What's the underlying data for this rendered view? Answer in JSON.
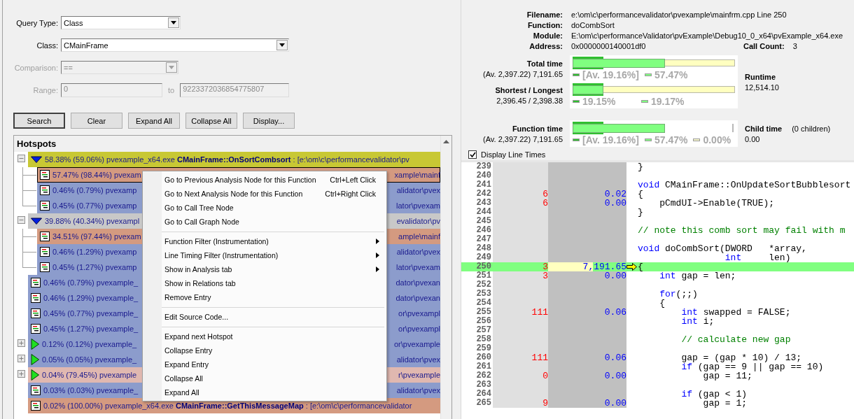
{
  "query_form": {
    "fields": [
      {
        "kind": "combo",
        "label": "Query Type:",
        "value": "Class",
        "disabled": false
      },
      {
        "kind": "combo",
        "label": "Class:",
        "value": "CMainFrame",
        "disabled": false
      },
      {
        "kind": "combo",
        "label": "Comparison:",
        "value": "==",
        "disabled": true
      },
      {
        "kind": "range",
        "label": "Range:",
        "value": "0",
        "separator": "to",
        "value_to": "9223372036854775807",
        "disabled": true
      }
    ],
    "buttons": [
      {
        "label": "Search",
        "default": true
      },
      {
        "label": "Clear",
        "default": false
      },
      {
        "label": "Expand All",
        "default": false
      },
      {
        "label": "Collapse All",
        "default": false
      },
      {
        "label": "Display...",
        "default": false
      }
    ]
  },
  "hotspots": {
    "title": "Hotspots",
    "rows": [
      {
        "kind": "group",
        "expanded": true,
        "selected": false,
        "color": "#c8c834",
        "text": "58.38% (59.06%) pvexample_x64.exe **CMainFrame::OnSortCombsort** : [e:\\om\\c\\performancevalidator\\pv",
        "children": [
          {
            "kind": "leaf",
            "selected": true,
            "color": "#d49a80",
            "text": "57.47% (98.44%) pvexam",
            "tail": "xample\\mainf"
          },
          {
            "kind": "leaf",
            "selected": false,
            "color": "#8c9ccc",
            "text": "0.46% (0.79%) pvexamp",
            "tail": "alidator\\pvex"
          },
          {
            "kind": "leaf",
            "selected": false,
            "color": "#8c9ccc",
            "text": "0.45% (0.77%) pvexamp",
            "tail": "lator\\pvexam"
          }
        ]
      },
      {
        "kind": "group",
        "expanded": true,
        "selected": false,
        "color": "#c8c8c8",
        "text": "39.88% (40.34%) pvexampl",
        "tail": "evalidator\\pv",
        "children": [
          {
            "kind": "leaf",
            "selected": false,
            "color": "#d49a80",
            "text": "34.51% (97.44%) pvexam",
            "tail": "ample\\mainf"
          },
          {
            "kind": "leaf",
            "selected": false,
            "color": "#8c9ccc",
            "text": "0.46% (1.29%) pvexamp",
            "tail": "alidator\\pvex"
          },
          {
            "kind": "leaf",
            "selected": false,
            "color": "#8c9ccc",
            "text": "0.45% (1.27%) pvexamp",
            "tail": "lator\\pvexam"
          }
        ]
      },
      {
        "kind": "leaf",
        "selected": false,
        "color": "#8c9ccc",
        "text": "0.46% (0.79%) pvexample_",
        "tail": "dator\\pvexan"
      },
      {
        "kind": "leaf",
        "selected": false,
        "color": "#8c9ccc",
        "text": "0.46% (1.29%) pvexample_",
        "tail": "dator\\pvexan"
      },
      {
        "kind": "leaf",
        "selected": false,
        "color": "#8c9ccc",
        "text": "0.45% (0.77%) pvexample_",
        "tail": "or\\pvexampl"
      },
      {
        "kind": "leaf",
        "selected": false,
        "color": "#8c9ccc",
        "text": "0.45% (1.27%) pvexample_",
        "tail": "or\\pvexampl"
      },
      {
        "kind": "group",
        "expanded": false,
        "selected": false,
        "color": "#8c9ccc",
        "text": "0.12% (0.12%) pvexample_",
        "tail": "or\\pvexample"
      },
      {
        "kind": "group",
        "expanded": false,
        "selected": false,
        "color": "#8c9ccc",
        "text": "0.05% (0.05%) pvexample_",
        "tail": "alidator\\pvex"
      },
      {
        "kind": "group",
        "expanded": false,
        "selected": false,
        "color": "#e0b8b0",
        "text": "0.04% (79.45%) pvexample",
        "tail": "r\\pvexample"
      },
      {
        "kind": "leaf",
        "selected": false,
        "color": "#8c9ccc",
        "text": "0.03% (0.03%) pvexample_",
        "tail": "alidator\\pvex"
      },
      {
        "kind": "leaf",
        "selected": false,
        "color": "#d49a80",
        "text": "0.02% (100.00%) pvexample_x64.exe **CMainFrame::GetThisMessageMap** : [e:\\om\\c\\performancevalidator"
      }
    ]
  },
  "context_menu": {
    "items": [
      {
        "kind": "item",
        "label": "Go to Previous Analysis Node for this Function",
        "shortcut": "Ctrl+Left Click",
        "submenu": false
      },
      {
        "kind": "item",
        "label": "Go to Next Analysis Node for this Function",
        "shortcut": "Ctrl+Right Click",
        "submenu": false
      },
      {
        "kind": "item",
        "label": "Go to Call Tree Node",
        "submenu": false
      },
      {
        "kind": "item",
        "label": "Go to Call Graph Node",
        "submenu": false
      },
      {
        "kind": "separator"
      },
      {
        "kind": "item",
        "label": "Function Filter (Instrumentation)",
        "submenu": true
      },
      {
        "kind": "item",
        "label": "Line Timing Filter (Instrumentation)",
        "submenu": true
      },
      {
        "kind": "item",
        "label": "Show in Analysis tab",
        "submenu": true
      },
      {
        "kind": "item",
        "label": "Show in Relations tab",
        "submenu": false
      },
      {
        "kind": "item",
        "label": "Remove Entry",
        "submenu": false
      },
      {
        "kind": "separator"
      },
      {
        "kind": "item",
        "label": "Edit Source Code...",
        "submenu": false
      },
      {
        "kind": "separator"
      },
      {
        "kind": "item",
        "label": "Expand next Hotspot",
        "submenu": false
      },
      {
        "kind": "item",
        "label": "Collapse Entry",
        "submenu": false
      },
      {
        "kind": "item",
        "label": "Expand Entry",
        "submenu": false
      },
      {
        "kind": "item",
        "label": "Collapse All",
        "submenu": false
      },
      {
        "kind": "item",
        "label": "Expand All",
        "submenu": false
      }
    ]
  },
  "details": {
    "fields": [
      {
        "label": "Filename:",
        "value": "e:\\om\\c\\performancevalidator\\pvexample\\mainfrm.cpp Line 250"
      },
      {
        "label": "Function:",
        "value": "doCombSort"
      },
      {
        "label": "Module:",
        "value": "E:\\om\\c\\performanceValidator\\pvExample\\Debug10_0_x64\\pvExample_x64.exe"
      },
      {
        "label": "Address:",
        "value": "0x0000000140001df0"
      }
    ],
    "call_count": {
      "label": "Call Count:",
      "value": "3"
    }
  },
  "timing_groups": [
    {
      "meters": [
        {
          "title": "Total time",
          "value": "(Av. 2,397.22) 7,191.65",
          "track": true,
          "fills": [
            {
              "kind": "avg",
              "level": 0.19
            },
            {
              "kind": "value",
              "level": 0.57
            }
          ],
          "legend": [
            {
              "kind": "avg",
              "text": "[Av. 19.16%]"
            },
            {
              "kind": "value",
              "text": "57.47%"
            }
          ]
        },
        {
          "title": "Shortest / Longest",
          "value": "2,396.45 / 2,398.38",
          "track": true,
          "fills": [
            {
              "kind": "avg",
              "level": 0.19
            },
            {
              "kind": "value",
              "level": 0.19
            }
          ],
          "legend": [
            {
              "kind": "avg",
              "text": "19.15%"
            },
            {
              "kind": "value",
              "text": "19.17%"
            }
          ]
        }
      ],
      "side": {
        "title": "Runtime",
        "value": "12,514.10"
      }
    },
    {
      "meters": [
        {
          "title": "Function time",
          "value": "(Av. 2,397.22) 7,191.65",
          "track": false,
          "fills": [
            {
              "kind": "avg",
              "level": 0.19
            },
            {
              "kind": "value",
              "level": 0.57
            }
          ],
          "legend": [
            {
              "kind": "avg",
              "text": "[Av. 19.16%]"
            },
            {
              "kind": "value",
              "text": "57.47%"
            },
            {
              "kind": "rest",
              "text": "0.00%"
            }
          ]
        }
      ],
      "side": {
        "title": "Child time",
        "note": "(0 children)",
        "value": "0.00"
      }
    }
  ],
  "line_times_option": {
    "label": "Display Line Times",
    "checked": true
  },
  "code_lines": [
    {
      "number": "239",
      "current": false,
      "tokens": [
        {
          "kind": "plain",
          "text": "}"
        }
      ]
    },
    {
      "number": "240",
      "current": false
    },
    {
      "number": "241",
      "current": false,
      "tokens": [
        {
          "kind": "keyword",
          "text": "void"
        },
        {
          "kind": "plain",
          "text": " CMainFrame::OnUpdateSortBubblesort"
        }
      ]
    },
    {
      "number": "242",
      "count": "6",
      "time": "0.02",
      "current": false,
      "tokens": [
        {
          "kind": "plain",
          "text": "{"
        }
      ]
    },
    {
      "number": "243",
      "count": "6",
      "time": "0.00",
      "current": false,
      "tokens": [
        {
          "kind": "plain",
          "text": "    pCmdUI->Enable(TRUE);"
        }
      ]
    },
    {
      "number": "244",
      "current": false,
      "tokens": [
        {
          "kind": "plain",
          "text": "}"
        }
      ]
    },
    {
      "number": "245",
      "current": false
    },
    {
      "number": "246",
      "current": false,
      "tokens": [
        {
          "kind": "comment",
          "text": "// note this comb sort may fail with m"
        }
      ]
    },
    {
      "number": "247",
      "current": false
    },
    {
      "number": "248",
      "current": false,
      "tokens": [
        {
          "kind": "keyword",
          "text": "void"
        },
        {
          "kind": "plain",
          "text": " doCombSort(DWORD   *array,"
        }
      ]
    },
    {
      "number": "249",
      "current": false,
      "tokens": [
        {
          "kind": "keyword",
          "text": "                int"
        },
        {
          "kind": "plain",
          "text": "     len)"
        }
      ]
    },
    {
      "number": "250",
      "count": "3",
      "time": "7,191.65",
      "level": 0.57,
      "current": true,
      "tokens": [
        {
          "kind": "plain",
          "text": "{"
        }
      ]
    },
    {
      "number": "251",
      "count": "3",
      "time": "0.00",
      "current": false,
      "tokens": [
        {
          "kind": "keyword",
          "text": "    int"
        },
        {
          "kind": "plain",
          "text": " gap = len;"
        }
      ]
    },
    {
      "number": "252",
      "current": false
    },
    {
      "number": "253",
      "current": false,
      "tokens": [
        {
          "kind": "keyword",
          "text": "    for"
        },
        {
          "kind": "plain",
          "text": "(;;)"
        }
      ]
    },
    {
      "number": "254",
      "current": false,
      "tokens": [
        {
          "kind": "plain",
          "text": "    {"
        }
      ]
    },
    {
      "number": "255",
      "count": "111",
      "time": "0.06",
      "current": false,
      "tokens": [
        {
          "kind": "keyword",
          "text": "        int"
        },
        {
          "kind": "plain",
          "text": " swapped = FALSE;"
        }
      ]
    },
    {
      "number": "256",
      "current": false,
      "tokens": [
        {
          "kind": "keyword",
          "text": "        int"
        },
        {
          "kind": "plain",
          "text": " i;"
        }
      ]
    },
    {
      "number": "257",
      "current": false
    },
    {
      "number": "258",
      "current": false,
      "tokens": [
        {
          "kind": "comment",
          "text": "        // calculate new gap"
        }
      ]
    },
    {
      "number": "259",
      "current": false
    },
    {
      "number": "260",
      "count": "111",
      "time": "0.06",
      "current": false,
      "tokens": [
        {
          "kind": "plain",
          "text": "        gap = (gap * 10) / 13;"
        }
      ]
    },
    {
      "number": "261",
      "current": false,
      "tokens": [
        {
          "kind": "keyword",
          "text": "        if"
        },
        {
          "kind": "plain",
          "text": " (gap == 9 || gap == 10)"
        }
      ]
    },
    {
      "number": "262",
      "count": "0",
      "time": "0.00",
      "current": false,
      "tokens": [
        {
          "kind": "plain",
          "text": "            gap = 11;"
        }
      ]
    },
    {
      "number": "263",
      "current": false
    },
    {
      "number": "264",
      "current": false,
      "tokens": [
        {
          "kind": "keyword",
          "text": "        if"
        },
        {
          "kind": "plain",
          "text": " (gap < 1)"
        }
      ]
    },
    {
      "number": "265",
      "count": "9",
      "time": "0.00",
      "current": false,
      "tokens": [
        {
          "kind": "plain",
          "text": "            gap = 1;"
        }
      ]
    }
  ]
}
